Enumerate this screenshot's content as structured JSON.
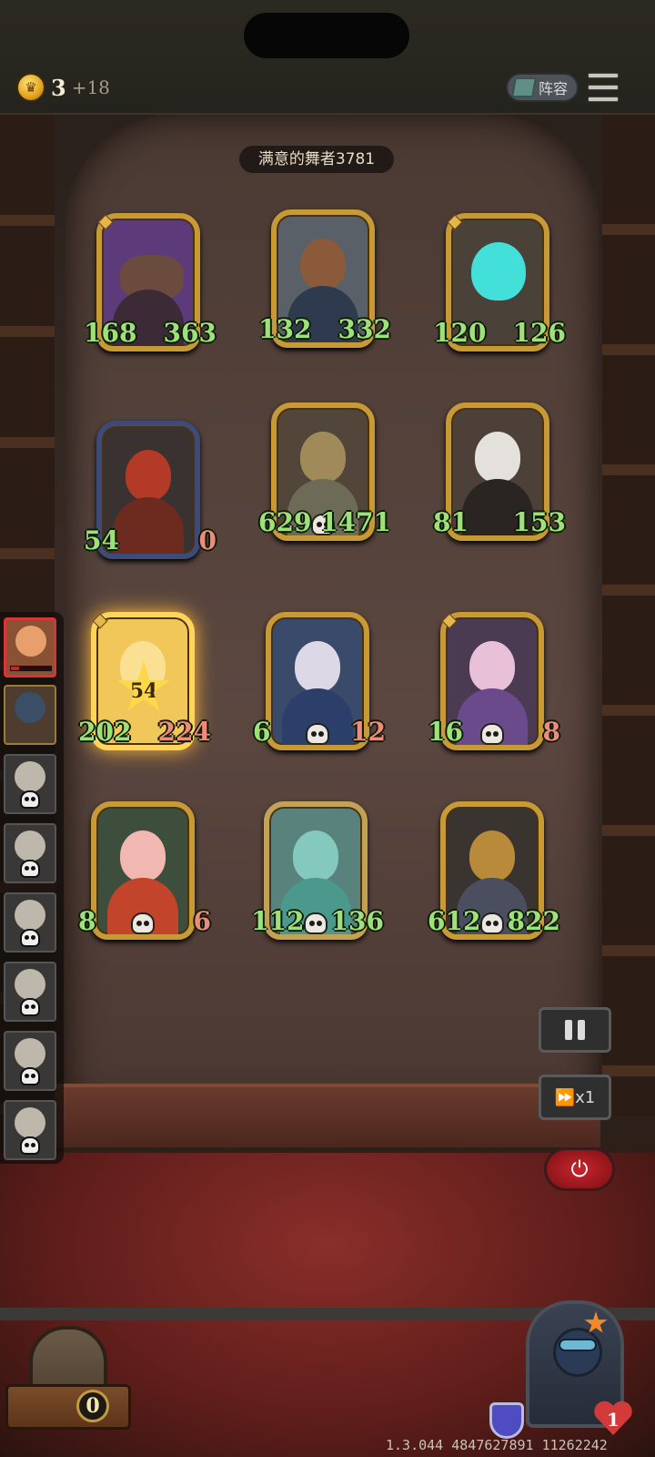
{
  "header": {
    "gold": "3",
    "gold_income": "+18",
    "lineup_label": "阵容",
    "icons": {
      "coin": "crown-coin-icon",
      "lineup": "book-icon",
      "menu": "hamburger-menu-icon"
    }
  },
  "board": {
    "title": "满意的舞者3781",
    "cards": [
      {
        "atk": "168",
        "hp": "363"
      },
      {
        "atk": "132",
        "hp": "332"
      },
      {
        "atk": "120",
        "hp": "126"
      },
      {
        "atk": "54",
        "hp": "0"
      },
      {
        "atk": "629",
        "hp": "1471"
      },
      {
        "atk": "81",
        "hp": "153"
      },
      {
        "atk": "202",
        "hp": "224",
        "star_value": "54"
      },
      {
        "atk": "6",
        "hp": "12"
      },
      {
        "atk": "16",
        "hp": "8"
      },
      {
        "atk": "8",
        "hp": "6"
      },
      {
        "atk": "112",
        "hp": "136"
      },
      {
        "atk": "612",
        "hp": "822"
      }
    ]
  },
  "controls": {
    "pause": "pause-icon",
    "speed": "x1",
    "power": "power-icon"
  },
  "bottom": {
    "chest_count": "0",
    "lives": "1",
    "version": "1.3.044 4847627891 11262242"
  },
  "colors": {
    "frame_gold": "#c89a36",
    "stat_green": "#9ee07a",
    "stat_red": "#f08a7a",
    "danger": "#c8262c"
  }
}
